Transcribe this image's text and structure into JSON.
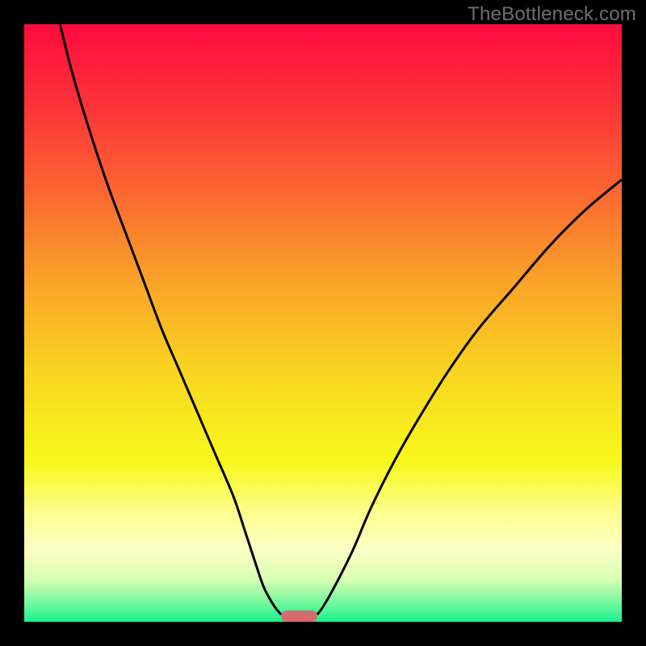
{
  "watermark": {
    "text": "TheBottleneck.com"
  },
  "chart_data": {
    "type": "line",
    "title": "",
    "xlabel": "",
    "ylabel": "",
    "xlim": [
      0,
      100
    ],
    "ylim": [
      0,
      100
    ],
    "grid": false,
    "legend": false,
    "background_gradient": {
      "stops": [
        {
          "pct": 0.0,
          "color": "#ff0b3e"
        },
        {
          "pct": 0.13,
          "color": "#fd3139"
        },
        {
          "pct": 0.28,
          "color": "#fb6631"
        },
        {
          "pct": 0.42,
          "color": "#faa029"
        },
        {
          "pct": 0.58,
          "color": "#f9d421"
        },
        {
          "pct": 0.73,
          "color": "#f8f81b"
        },
        {
          "pct": 0.82,
          "color": "#fbff90"
        },
        {
          "pct": 0.88,
          "color": "#fdffc6"
        },
        {
          "pct": 0.93,
          "color": "#d5ffb1"
        },
        {
          "pct": 0.965,
          "color": "#7cf9a1"
        },
        {
          "pct": 1.0,
          "color": "#19f28d"
        }
      ]
    },
    "series": [
      {
        "name": "curve-left",
        "x": [
          6,
          8,
          11,
          14,
          17,
          20,
          23,
          26,
          29,
          32,
          35,
          37,
          38.8,
          40,
          41,
          42,
          43
        ],
        "y": [
          100,
          92,
          82,
          73,
          65,
          57,
          49,
          42,
          35,
          28,
          21,
          15,
          9.5,
          6,
          4,
          2.4,
          1.2
        ]
      },
      {
        "name": "curve-right",
        "x": [
          49,
          50,
          52,
          55,
          58,
          62,
          66,
          71,
          76,
          82,
          88,
          94,
          100
        ],
        "y": [
          1.2,
          2.5,
          6,
          12,
          19,
          27,
          34,
          42,
          49,
          56,
          63,
          69,
          74
        ]
      }
    ],
    "marker": {
      "x_center": 46,
      "width": 6,
      "height": 1.9,
      "color": "#d76a6f"
    }
  },
  "colors": {
    "frame_bg": "#000000",
    "curve": "#000000",
    "watermark": "#6e6e6e"
  }
}
